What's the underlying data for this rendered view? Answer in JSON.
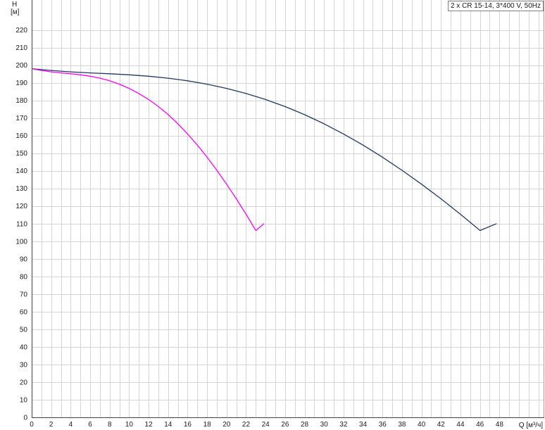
{
  "chart_data": {
    "type": "line",
    "title": "2 x CR 15-14, 3*400 V, 50Hz",
    "ylabel": "H",
    "yunit": "[м]",
    "xlabel": "Q [м³/ч]",
    "xlim": [
      0,
      52.6
    ],
    "ylim": [
      0,
      237
    ],
    "x_ticks": [
      0,
      2,
      4,
      6,
      8,
      10,
      12,
      14,
      16,
      18,
      20,
      22,
      24,
      26,
      28,
      30,
      32,
      34,
      36,
      38,
      40,
      42,
      44,
      46,
      48
    ],
    "y_ticks": [
      0,
      10,
      20,
      30,
      40,
      50,
      60,
      70,
      80,
      90,
      100,
      110,
      120,
      130,
      140,
      150,
      160,
      170,
      180,
      190,
      200,
      210,
      220
    ],
    "grid": true,
    "legend_position": "top-right",
    "series": [
      {
        "color": "#1f3864",
        "x": [
          0,
          2,
          4,
          6,
          8,
          10,
          12,
          14,
          16,
          18,
          20,
          22,
          24,
          26,
          28,
          30,
          32,
          34,
          36,
          38,
          40,
          42,
          44,
          46,
          47.7
        ],
        "y": [
          198,
          197,
          196.2,
          195.6,
          195.1,
          194.5,
          193.7,
          192.6,
          191.1,
          189.2,
          186.8,
          183.9,
          180.5,
          176.5,
          171.9,
          166.7,
          160.9,
          154.6,
          147.7,
          140.3,
          132.4,
          124.1,
          115.3,
          106.1,
          110
        ]
      },
      {
        "color": "#ff00ff",
        "x": [
          0,
          1,
          2,
          3,
          4,
          5,
          6,
          7,
          8,
          9,
          10,
          11,
          12,
          13,
          14,
          15,
          16,
          17,
          18,
          19,
          20,
          21,
          22,
          23,
          23.85
        ],
        "y": [
          198,
          197,
          196.2,
          195.6,
          195.1,
          194.5,
          193.7,
          192.6,
          191.1,
          189.2,
          186.8,
          183.9,
          180.5,
          176.5,
          171.9,
          166.7,
          160.9,
          154.6,
          147.7,
          140.3,
          132.4,
          124.1,
          115.3,
          106.1,
          110
        ]
      }
    ]
  }
}
